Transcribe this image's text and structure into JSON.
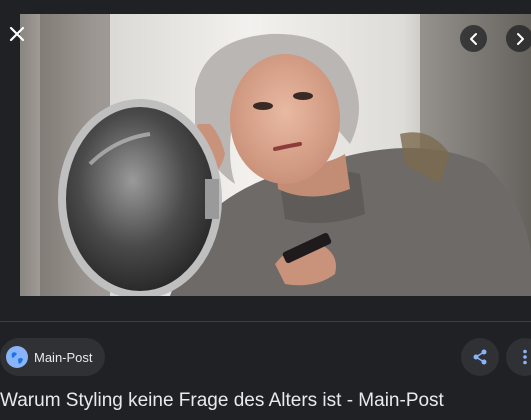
{
  "viewer": {
    "close_icon": "close-icon",
    "prev_icon": "chevron-left-icon",
    "next_icon": "chevron-right-icon"
  },
  "source": {
    "label": "Main-Post",
    "icon": "globe-icon"
  },
  "actions": {
    "share_icon": "share-icon",
    "more_icon": "more-vertical-icon"
  },
  "title": "Warum Styling keine Frage des Alters ist - Main-Post",
  "colors": {
    "background": "#202124",
    "chip": "#303134",
    "text": "#e8eaed",
    "accent": "#8ab4f8"
  }
}
